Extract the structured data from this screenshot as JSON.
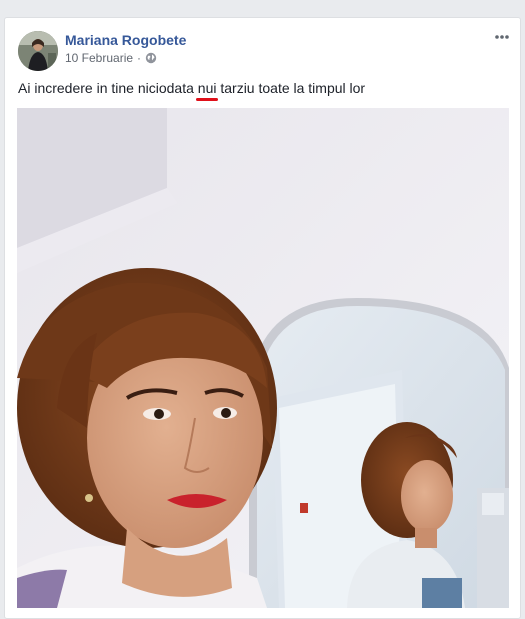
{
  "post": {
    "author": "Mariana Rogobete",
    "date": "10 Februarie",
    "separator": "·",
    "text_before": "Ai incredere in tine niciodata ",
    "text_misspelled": "nui",
    "text_after": " tarziu toate la timpul lor",
    "privacy_icon": "globe-icon",
    "menu_icon": "more-options-icon"
  },
  "colors": {
    "author_link": "#365899",
    "meta_text": "#616770",
    "spellcheck_underline": "#e0101a",
    "feed_background": "#e9ebee"
  }
}
